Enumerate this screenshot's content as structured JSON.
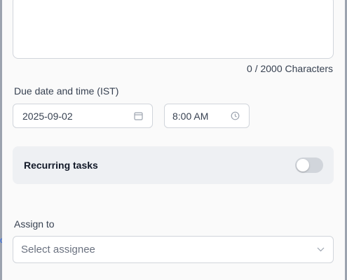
{
  "description": {
    "char_count": "0 / 2000 Characters"
  },
  "due": {
    "label": "Due date and time (IST)",
    "date_value": "2025-09-02",
    "date_icon": "calendar-icon",
    "time_value": "8:00 AM",
    "time_icon": "clock-icon"
  },
  "recurring": {
    "label": "Recurring tasks",
    "enabled": false
  },
  "assign": {
    "label": "Assign to",
    "placeholder": "Select assignee",
    "icon": "chevron-down-icon"
  },
  "colors": {
    "panel_bg": "#fafafa",
    "border": "#d1d5db",
    "card_bg": "#eef0f3",
    "toggle_off": "#d1d5db",
    "placeholder_text": "#6b7280"
  }
}
